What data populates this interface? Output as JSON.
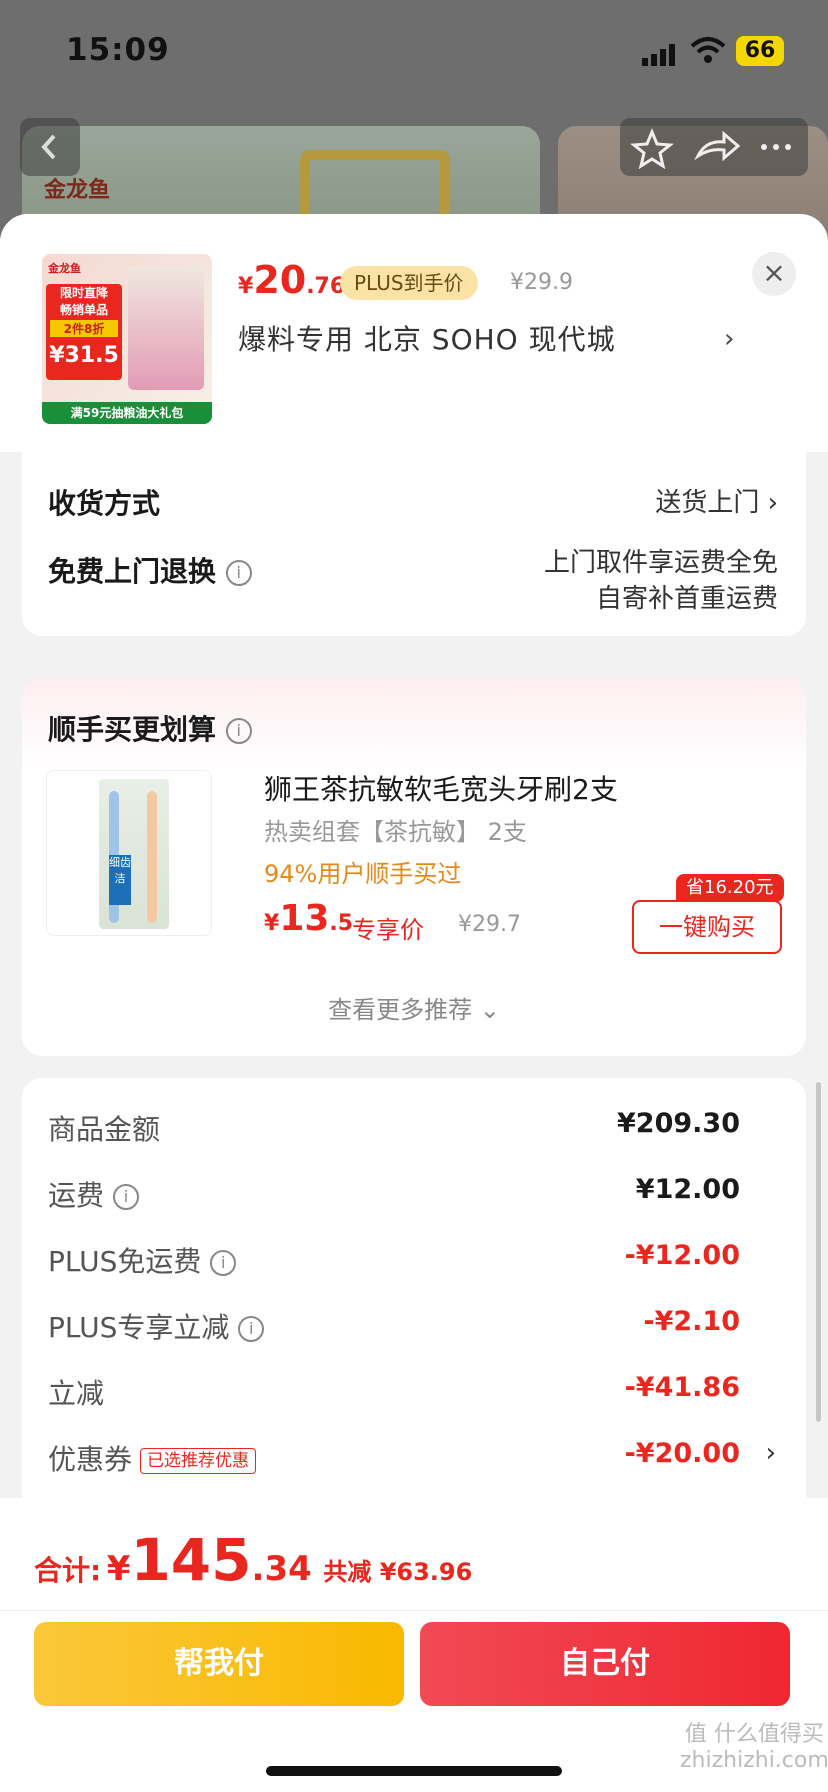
{
  "status_bar": {
    "time": "15:09",
    "battery": "66"
  },
  "background": {
    "brand_logo": "金龙鱼"
  },
  "product": {
    "brand": "金龙鱼",
    "image_tags": [
      "限时直降",
      "畅销单品",
      "2件8折"
    ],
    "image_price": "¥31.5",
    "image_banner": "满59元抽粮油大礼包",
    "price_currency": "¥",
    "price_int": "20",
    "price_dec": ".76",
    "plus_label": "PLUS到手价",
    "original_price": "¥29.9",
    "location": "爆料专用  北京 SOHO 现代城",
    "location_arrow": "›",
    "close": "×"
  },
  "delivery": {
    "method_label": "收货方式",
    "method_value": "送货上门 ›",
    "return_label": "免费上门退换",
    "return_value_1": "上门取件享运费全免",
    "return_value_2": "自寄补首重运费"
  },
  "addon": {
    "title": "顺手买更划算",
    "name": "狮王茶抗敏软毛宽头牙刷2支",
    "sub": "热卖组套【茶抗敏】 2支",
    "percent": "94%用户顺手买过",
    "price_currency": "¥",
    "price_int": "13",
    "price_dec": ".5",
    "exclusive": "专享价",
    "original": "¥29.7",
    "save_badge": "省16.20元",
    "buy_button": "一键购买",
    "more": "查看更多推荐 ⌄",
    "image_band": "细齿洁"
  },
  "summary": {
    "rows": [
      {
        "label": "商品金额",
        "value": "¥209.30"
      },
      {
        "label": "运费",
        "value": "¥12.00"
      },
      {
        "label": "PLUS免运费",
        "value": "-¥12.00"
      },
      {
        "label": "PLUS专享立减",
        "value": "-¥2.10"
      },
      {
        "label": "立减",
        "value": "-¥41.86"
      },
      {
        "label": "优惠券",
        "value": "-¥20.00",
        "badge": "已选推荐优惠"
      }
    ]
  },
  "footer": {
    "total_label": "合计:",
    "total_currency": "¥",
    "total_int": "145",
    "total_dec": ".34",
    "saved": "共减 ¥63.96",
    "help_pay": "帮我付",
    "self_pay": "自己付"
  },
  "watermark": "值 什么值得买\nzhizhizhi.com",
  "colors": {
    "accent_red": "#e9271e",
    "yellow": "#f9b900",
    "pay_red": "#ef2732"
  }
}
